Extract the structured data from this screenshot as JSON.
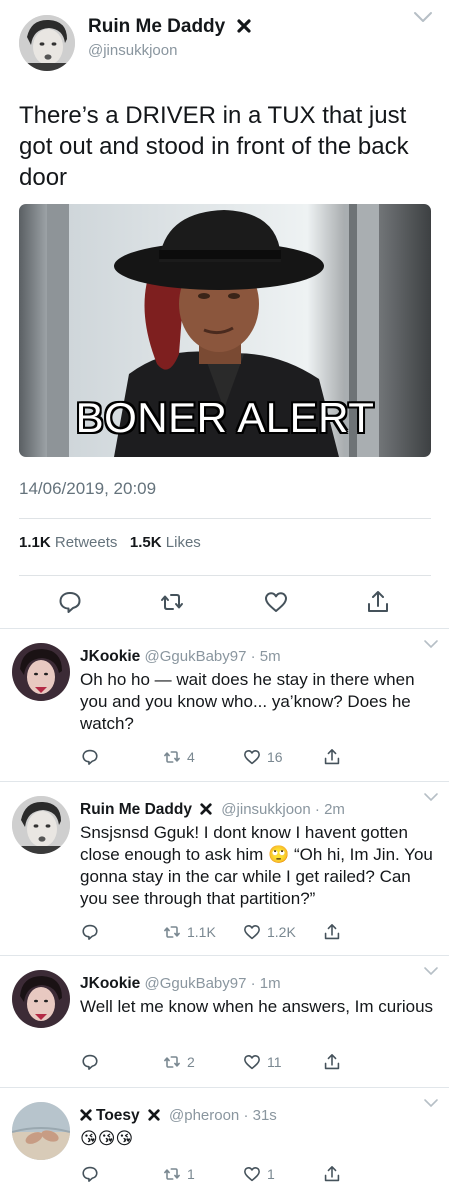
{
  "tweet": {
    "display_name": "Ruin Me Daddy",
    "handle": "@jinsukkjoon",
    "name_icon": "x-mark-icon",
    "text": "There’s a DRIVER in a TUX that just got out and stood in front of the back door",
    "gif_caption": "BONER ALERT",
    "timestamp": "14/06/2019, 20:09",
    "retweets_count": "1.1K",
    "retweets_label": "Retweets",
    "likes_count": "1.5K",
    "likes_label": "Likes"
  },
  "replies": [
    {
      "name": "JKookie",
      "handle": "@GgukBaby97 · 5m",
      "text": "Oh ho ho — wait does he stay in there when you and you know who... ya’know? Does he watch?",
      "retweets": "4",
      "likes": "16"
    },
    {
      "name": "Ruin Me Daddy",
      "name_icon": "x-mark-icon",
      "handle": "@jinsukkjoon · 2m",
      "text": "Snsjsnsd Gguk! I dont know I havent gotten close enough to ask him 🙄 “Oh hi, Im Jin. You gonna stay in the car while I get railed? Can you see through that partition?”",
      "retweets": "1.1K",
      "likes": "1.2K"
    },
    {
      "name": "JKookie",
      "handle": "@GgukBaby97 · 1m",
      "text": "Well let me know when he answers, Im curious",
      "retweets": "2",
      "likes": "11"
    },
    {
      "name": "Toesy",
      "name_prefix_icon": "x-mark-icon",
      "name_icon": "x-mark-icon",
      "handle": "@pheroon · 31s",
      "text": "😘😘😘",
      "retweets": "1",
      "likes": "1"
    }
  ],
  "colors": {
    "text": "#14171a",
    "secondary": "#65737c",
    "divider": "#e1e6ea",
    "icon": "#7a8891"
  }
}
